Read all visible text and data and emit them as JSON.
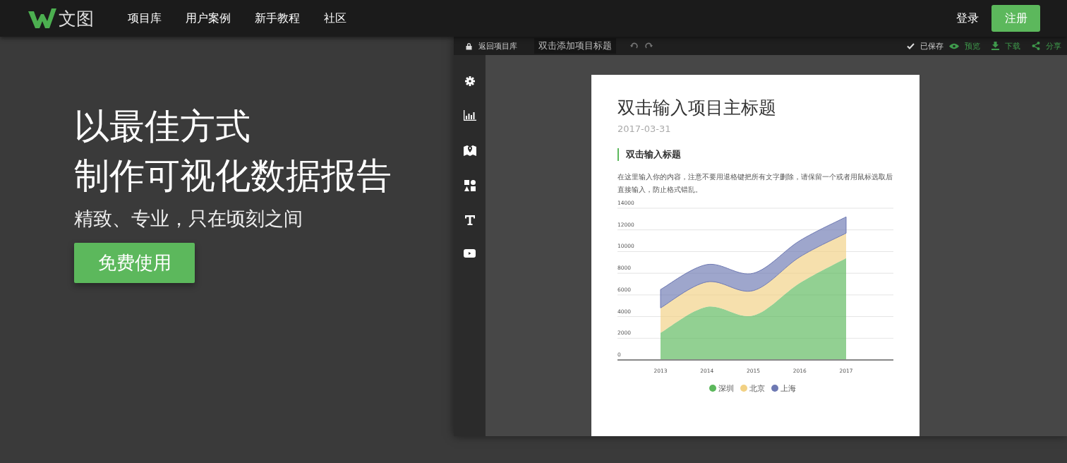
{
  "nav": {
    "logo_text": "文图",
    "links": [
      "项目库",
      "用户案例",
      "新手教程",
      "社区"
    ],
    "login": "登录",
    "register": "注册"
  },
  "hero": {
    "title_lines": [
      "以最佳方式",
      "制作可视化数据报告"
    ],
    "subtitle": "精致、专业，只在顷刻之间",
    "cta": "免费使用"
  },
  "editor": {
    "toolbar": {
      "back": "返回项目库",
      "title_field": "双击添加项目标题",
      "saved": "已保存",
      "actions": [
        {
          "kind": "preview",
          "label": "预览"
        },
        {
          "kind": "download",
          "label": "下载"
        },
        {
          "kind": "share",
          "label": "分享"
        }
      ]
    },
    "sidebar": [
      {
        "kind": "settings"
      },
      {
        "kind": "chart"
      },
      {
        "kind": "map"
      },
      {
        "kind": "shapes"
      },
      {
        "kind": "text"
      },
      {
        "kind": "video"
      }
    ],
    "page": {
      "title": "双击输入项目主标题",
      "date": "2017-03-31",
      "section_heading": "双击输入标题",
      "paragraph": "在这里输入你的内容，注意不要用退格键把所有文字删除，请保留一个或者用鼠标选取后直接输入，防止格式错乱。",
      "chart_data": {
        "type": "area",
        "stacked": true,
        "grid": true,
        "legend": true,
        "categories": [
          "2013",
          "2014",
          "2015",
          "2016",
          "2017"
        ],
        "ylim": [
          0,
          14000
        ],
        "yticks": [
          0,
          2000,
          4000,
          6000,
          8000,
          10000,
          12000,
          14000
        ],
        "series": [
          {
            "name": "深圳",
            "color": "#5cb85c",
            "values": [
              2500,
              4900,
              4100,
              7100,
              9400
            ]
          },
          {
            "name": "北京",
            "color": "#f2d184",
            "values": [
              2300,
              2300,
              2300,
              2400,
              2300
            ]
          },
          {
            "name": "上海",
            "color": "#6e79b3",
            "values": [
              1700,
              1600,
              1600,
              1500,
              1500
            ]
          }
        ]
      }
    }
  }
}
